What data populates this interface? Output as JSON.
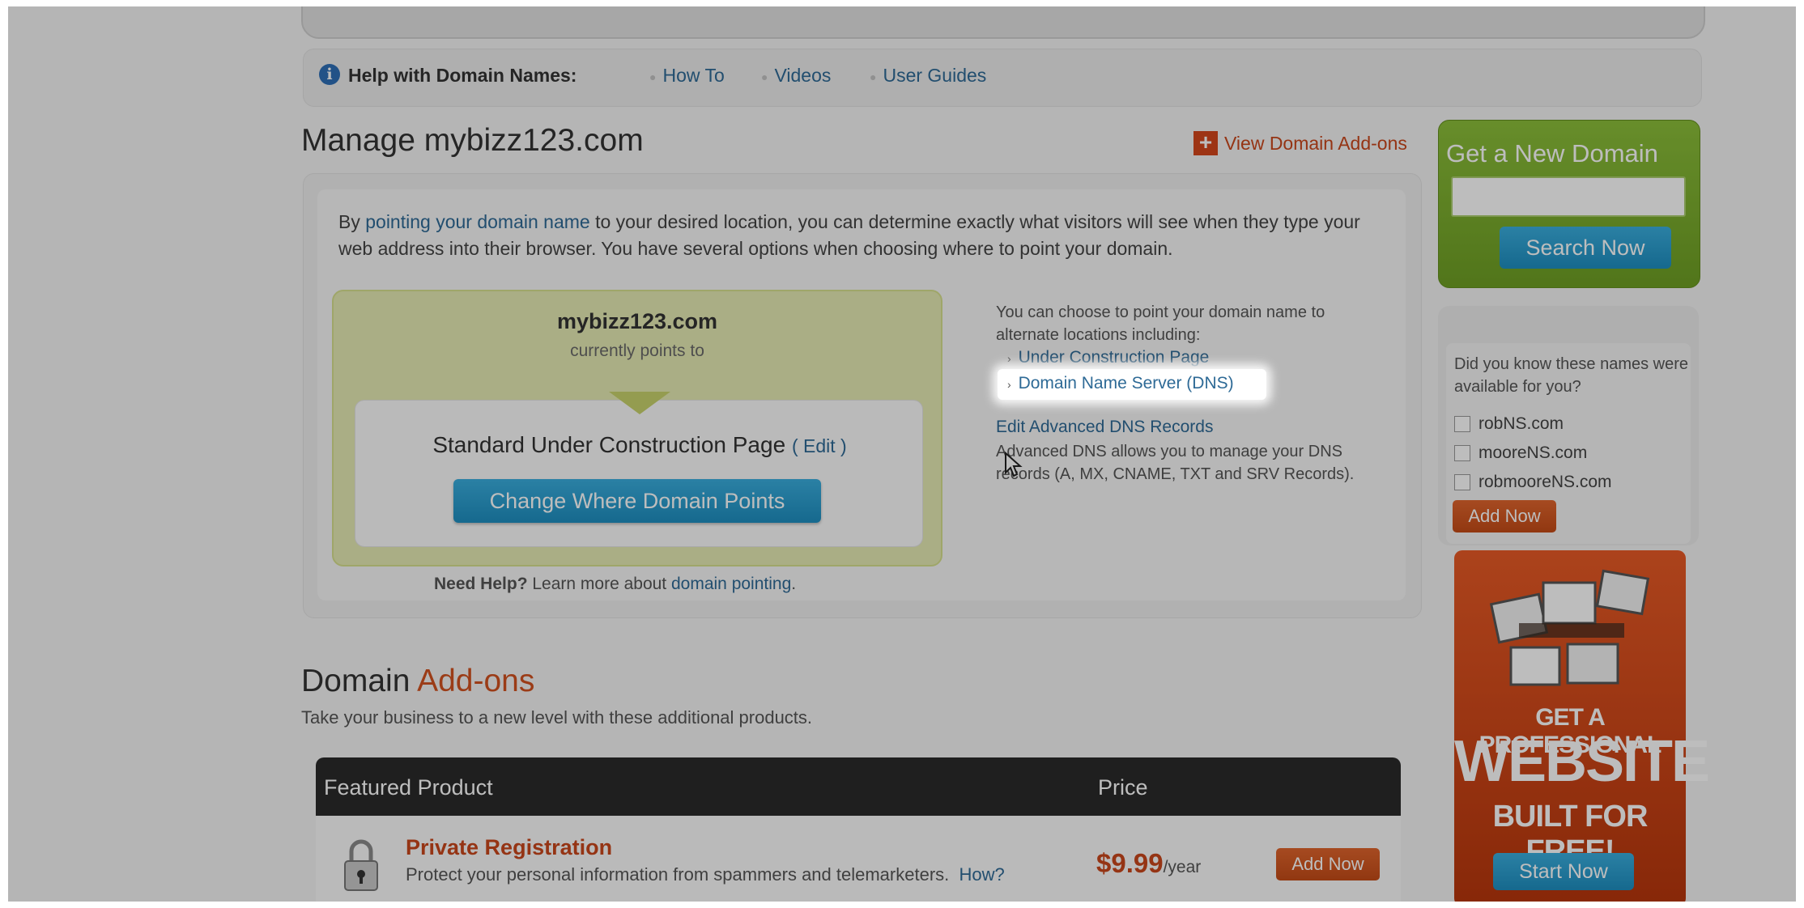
{
  "help_bar": {
    "title": "Help with Domain Names:",
    "links": [
      "How To",
      "Videos",
      "User Guides"
    ]
  },
  "manage": {
    "title": "Manage mybizz123.com",
    "view_addons": "View Domain Add-ons",
    "intro_prefix": "By ",
    "intro_link": "pointing your domain name",
    "intro_suffix": " to your desired location, you can determine exactly what visitors will see when they type your web address into their browser. You have several options when choosing where to point your domain.",
    "domain": "mybizz123.com",
    "points_to": "currently points to",
    "current_target": "Standard Under Construction Page",
    "edit": "( Edit )",
    "change_button": "Change Where Domain Points",
    "need_help_bold": "Need Help?",
    "need_help_text": " Learn more about ",
    "need_help_link": "domain pointing",
    "options_text": "You can choose to point your domain name to alternate locations including:",
    "option_1": "Under Construction Page",
    "option_2": "Domain Name Server (DNS)",
    "advanced_link": "Edit Advanced DNS Records",
    "advanced_desc": "Advanced DNS allows you to manage your DNS records (A, MX, CNAME, TXT and SRV Records)."
  },
  "addons": {
    "title_1": "Domain ",
    "title_2": "Add-ons",
    "subtitle": "Take your business to a new level with these additional products.",
    "col_product": "Featured Product",
    "col_price": "Price",
    "product_name": "Private Registration",
    "product_desc": "Protect your personal information from spammers and telemarketers.",
    "how": "How?",
    "price": "$9.99",
    "per": "/year",
    "add_button": "Add Now"
  },
  "sidebar": {
    "new_domain_title": "Get a New Domain",
    "search_value": "",
    "search_button": "Search Now",
    "suggest_title": "Did you know these names were available for you?",
    "suggestions": [
      "robNS.com",
      "mooreNS.com",
      "robmooreNS.com"
    ],
    "add_now": "Add Now",
    "ad_line1": "GET A PROFESSIONAL",
    "ad_line2": "WEBSITE",
    "ad_line3": "BUILT FOR FREE!",
    "ad_button": "Start Now"
  }
}
